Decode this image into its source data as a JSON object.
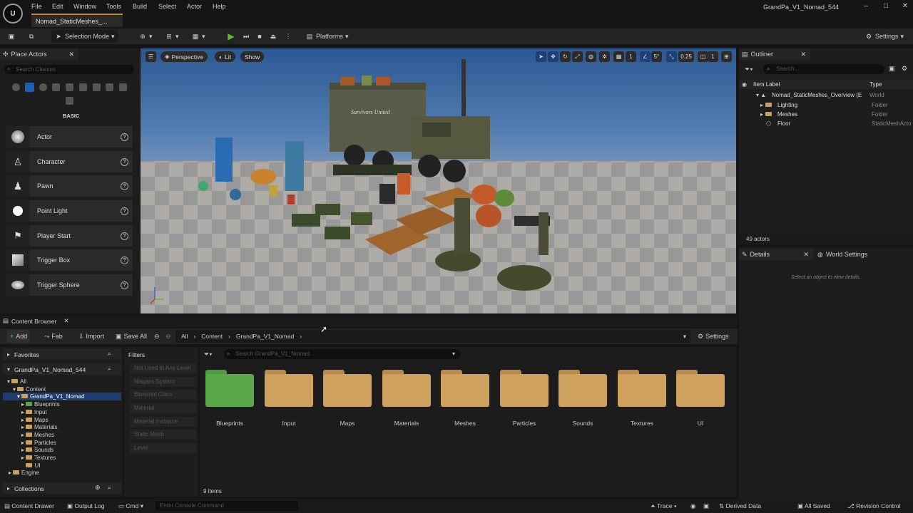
{
  "window": {
    "title": "GrandPa_V1_Nomad_544",
    "document_tab": "Nomad_StaticMeshes_...",
    "menu": [
      "File",
      "Edit",
      "Window",
      "Tools",
      "Build",
      "Select",
      "Actor",
      "Help"
    ]
  },
  "toolbar": {
    "selection_mode": "Selection Mode",
    "platforms": "Platforms",
    "settings": "Settings"
  },
  "place_actors": {
    "tab": "Place Actors",
    "search_placeholder": "Search Classes",
    "category": "BASIC",
    "items": [
      "Actor",
      "Character",
      "Pawn",
      "Point Light",
      "Player Start",
      "Trigger Box",
      "Trigger Sphere"
    ]
  },
  "viewport": {
    "perspective": "Perspective",
    "lit": "Lit",
    "show": "Show",
    "grid_size": "1",
    "angle_snap": "5°",
    "scale_snap": "0.25",
    "camera_speed": "1",
    "truck_sign": "Survivors United"
  },
  "outliner": {
    "tab": "Outliner",
    "search_placeholder": "Search...",
    "col_label": "Item Label",
    "col_type": "Type",
    "rows": [
      {
        "label": "Nomad_StaticMeshes_Overview (E",
        "type": "World"
      },
      {
        "label": "Lighting",
        "type": "Folder"
      },
      {
        "label": "Meshes",
        "type": "Folder"
      },
      {
        "label": "Floor",
        "type": "StaticMeshActo"
      }
    ],
    "count": "49 actors"
  },
  "details": {
    "tab": "Details",
    "tab2": "World Settings",
    "empty_message": "Select an object to view details."
  },
  "content_browser": {
    "tab": "Content Browser",
    "add": "Add",
    "fab": "Fab",
    "import": "Import",
    "save_all": "Save All",
    "breadcrumb": [
      "All",
      "Content",
      "GrandPa_V1_Nomad"
    ],
    "settings": "Settings",
    "favorites": "Favorites",
    "project_root": "GrandPa_V1_Nomad_544",
    "tree": [
      "All",
      "Content",
      "GrandPa_V1_Nomad",
      "Blueprints",
      "Input",
      "Maps",
      "Materials",
      "Meshes",
      "Particles",
      "Sounds",
      "Textures",
      "UI",
      "Engine"
    ],
    "collections": "Collections",
    "filters_label": "Filters",
    "filters": [
      "Not Used In Any Level",
      "Niagara System",
      "Blueprint Class",
      "Material",
      "Material Instance",
      "Static Mesh",
      "Level"
    ],
    "search_placeholder": "Search GrandPa_V1_Nomad",
    "folders": [
      "Blueprints",
      "Input",
      "Maps",
      "Materials",
      "Meshes",
      "Particles",
      "Sounds",
      "Textures",
      "UI"
    ],
    "item_count": "9 items"
  },
  "status_bar": {
    "content_drawer": "Content Drawer",
    "output_log": "Output Log",
    "cmd": "Cmd",
    "console_placeholder": "Enter Console Command",
    "trace": "Trace",
    "derived_data": "Derived Data",
    "all_saved": "All Saved",
    "revision_control": "Revision Control"
  },
  "colors": {
    "accent": "#c08a2a",
    "folder": "#cfa15f",
    "blueprints_folder": "#5aa84a",
    "selection": "#1f3f75"
  }
}
